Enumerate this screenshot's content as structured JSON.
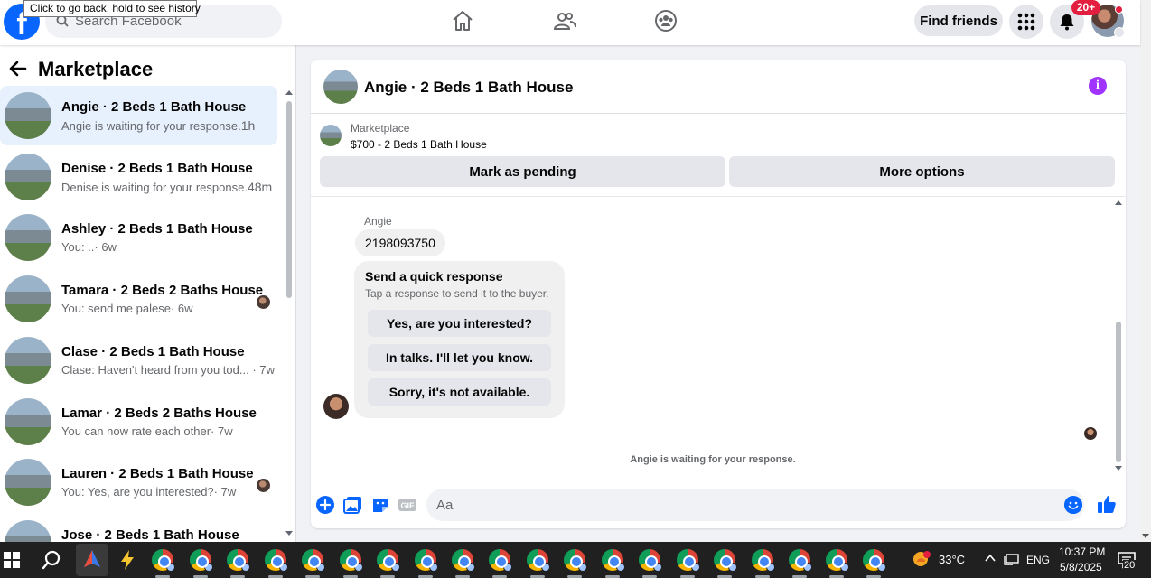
{
  "browser": {
    "tooltip": "Click to go back, hold to see history"
  },
  "header": {
    "logo_text": "f",
    "search_placeholder": "Search Facebook",
    "nav": [
      "home-icon",
      "friends-icon",
      "groups-icon"
    ],
    "find_friends_label": "Find friends",
    "notification_badge": "20+"
  },
  "sidebar": {
    "title": "Marketplace",
    "conversations": [
      {
        "name": "Angie · 2 Beds 1 Bath House",
        "preview": "Angie is waiting for your response.",
        "time": "1h",
        "active": true,
        "read_avatar": false
      },
      {
        "name": "Denise · 2 Beds 1 Bath House",
        "preview": "Denise is waiting for your response.",
        "time": "48m",
        "active": false,
        "read_avatar": false
      },
      {
        "name": "Ashley · 2 Beds 1 Bath House",
        "preview": "You: ..",
        "time": "· 6w",
        "active": false,
        "read_avatar": false
      },
      {
        "name": "Tamara · 2 Beds 2 Baths House",
        "preview": "You: send me palese",
        "time": "· 6w",
        "active": false,
        "read_avatar": true
      },
      {
        "name": "Clase · 2 Beds 1 Bath House",
        "preview": "Clase: Haven't heard from you tod...",
        "time": " · 7w",
        "active": false,
        "read_avatar": false
      },
      {
        "name": "Lamar · 2 Beds 2 Baths House",
        "preview": "You can now rate each other",
        "time": "· 7w",
        "active": false,
        "read_avatar": false
      },
      {
        "name": "Lauren · 2 Beds 1 Bath House",
        "preview": "You: Yes, are you interested?",
        "time": "· 7w",
        "active": false,
        "read_avatar": true
      },
      {
        "name": "Jose · 2 Beds 1 Bath House",
        "preview": "",
        "time": "",
        "active": false,
        "read_avatar": false
      }
    ]
  },
  "chat": {
    "title": "Angie · 2 Beds 1 Bath House",
    "info_symbol": "i",
    "listing": {
      "source": "Marketplace",
      "price_title": "$700 - 2 Beds 1 Bath House",
      "mark_pending_label": "Mark as pending",
      "more_options_label": "More options"
    },
    "sender": "Angie",
    "message": "2198093750",
    "quick_response": {
      "title": "Send a quick response",
      "subtitle": "Tap a response to send it to the buyer.",
      "options": [
        "Yes, are you interested?",
        "In talks. I'll let you know.",
        "Sorry, it's not available."
      ]
    },
    "waiting_note": "Angie is waiting for your response.",
    "composer_placeholder": "Aa"
  },
  "taskbar": {
    "weather": "33°C",
    "language": "ENG",
    "time": "10:37 PM",
    "date": "5/8/2025",
    "notification_count": "20"
  },
  "colors": {
    "brand_blue": "#0866ff",
    "active_item": "#e7f0fd",
    "info_purple": "#a033ff",
    "badge_red": "#e41e3f"
  }
}
